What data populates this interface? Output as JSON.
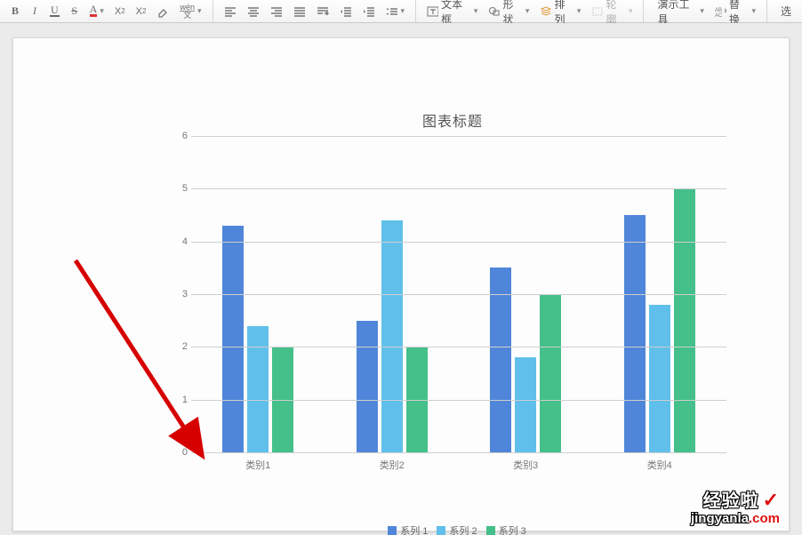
{
  "toolbar": {
    "textbox": "文本框",
    "shape": "形状",
    "arrange": "排列",
    "outline": "轮廓",
    "present": "演示工具",
    "replace": "替换",
    "pick": "选"
  },
  "chart_data": {
    "type": "bar",
    "title": "图表标题",
    "ylim": [
      0,
      6
    ],
    "yticks": [
      0,
      1,
      2,
      3,
      4,
      5,
      6
    ],
    "categories": [
      "类别1",
      "类别2",
      "类别3",
      "类别4"
    ],
    "series": [
      {
        "name": "系列 1",
        "color": "#4f86d9",
        "values": [
          4.3,
          2.5,
          3.5,
          4.5
        ]
      },
      {
        "name": "系列 2",
        "color": "#60c0eb",
        "values": [
          2.4,
          4.4,
          1.8,
          2.8
        ]
      },
      {
        "name": "系列 3",
        "color": "#45c08b",
        "values": [
          2.0,
          2.0,
          3.0,
          5.0
        ]
      }
    ],
    "xlabel": "",
    "ylabel": ""
  },
  "watermark": {
    "line1": "经验啦",
    "line2_main": "jingyanla",
    "line2_ext": ".com"
  }
}
